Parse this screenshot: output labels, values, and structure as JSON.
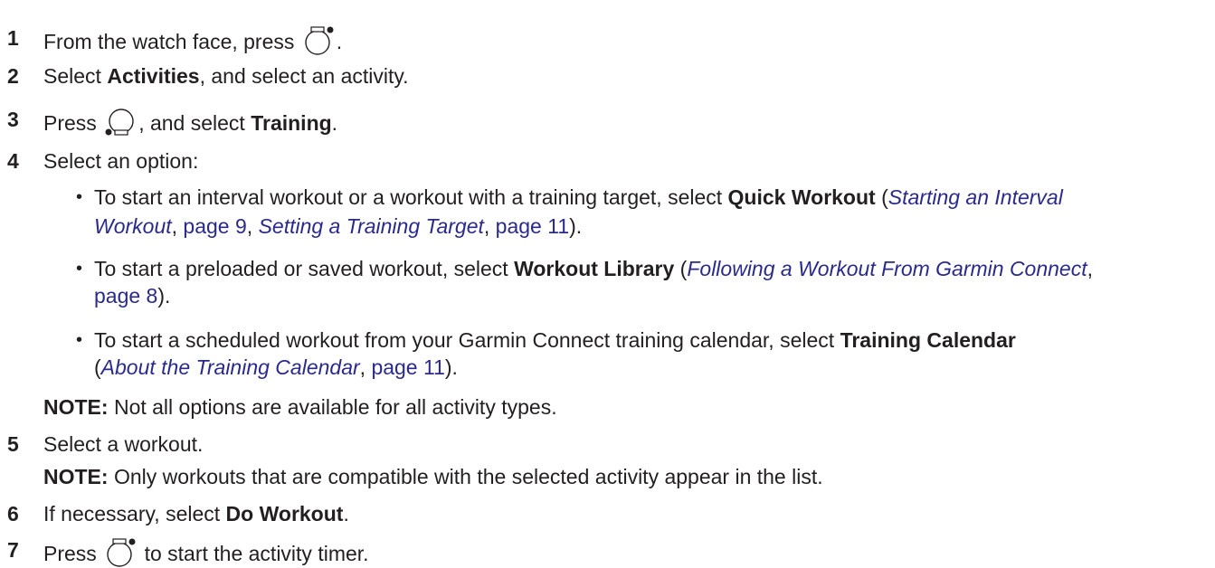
{
  "steps": [
    {
      "num": "1",
      "pre": "From the watch face, press",
      "post": ".",
      "icon": "watch-start-button-icon"
    },
    {
      "num": "2",
      "pre": "Select ",
      "bold": "Activities",
      "post": ", and select an activity."
    },
    {
      "num": "3",
      "pre": "Press",
      "post": ", and select ",
      "bold": "Training",
      "post2": ".",
      "icon": "watch-menu-button-icon"
    },
    {
      "num": "4",
      "text": "Select an option:"
    },
    {
      "num": "5",
      "text": "Select a workout."
    },
    {
      "num": "6",
      "pre": "If necessary, select ",
      "bold": "Do Workout",
      "post": "."
    },
    {
      "num": "7",
      "pre": "Press",
      "post": " to start the activity timer.",
      "icon": "watch-start-button-icon"
    }
  ],
  "options": [
    {
      "pre": "To start an interval workout or a workout with a training target, select ",
      "bold": "Quick Workout",
      "mid": " (",
      "xref1": "Starting an Interval",
      "xref1b": "Workout",
      "sep1": ", ",
      "page1": "page 9",
      "sep2": ", ",
      "xref2": "Setting a Training Target",
      "sep3": ", ",
      "page2": "page 11",
      "end": ")."
    },
    {
      "pre": "To start a preloaded or saved workout, select ",
      "bold": "Workout Library",
      "mid": " (",
      "xref1": "Following a Workout From Garmin Connect",
      "sep1": ",",
      "page1": "page 8",
      "end": ")."
    },
    {
      "pre": "To start a scheduled workout from your Garmin Connect training calendar, select ",
      "bold": "Training Calendar",
      "mid": "(",
      "xref1": "About the Training Calendar",
      "sep1": ", ",
      "page1": "page 11",
      "end": ")."
    }
  ],
  "notes": {
    "note1_label": "NOTE:",
    "note1_text": " Not all options are available for all activity types.",
    "note2_label": "NOTE:",
    "note2_text": " Only workouts that are compatible with the selected activity appear in the list."
  },
  "bullet_char": "•",
  "colors": {
    "text": "#231f20",
    "link": "#2a2a8c"
  }
}
